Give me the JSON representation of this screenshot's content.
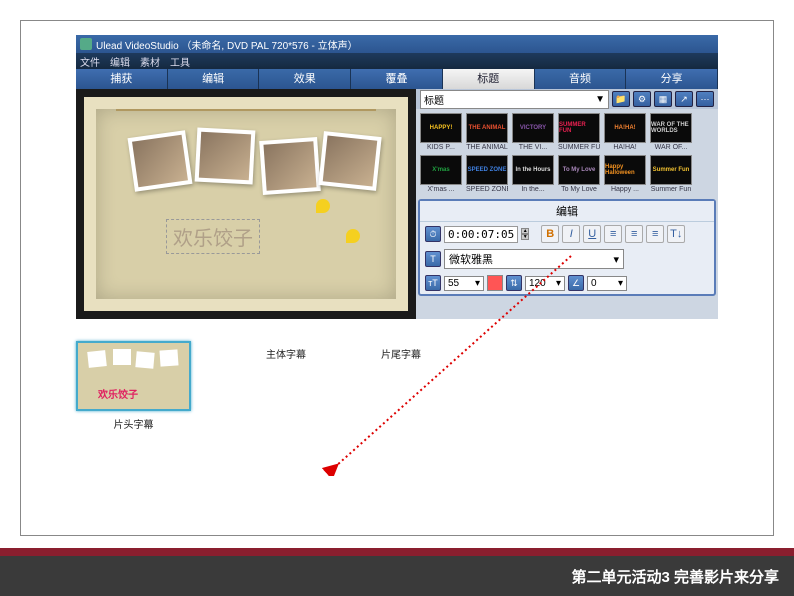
{
  "titlebar": {
    "text": "Ulead VideoStudio （未命名, DVD PAL 720*576 - 立体声）"
  },
  "menu": {
    "file": "文件",
    "edit": "编辑",
    "clip": "素材",
    "tools": "工具"
  },
  "tabs": {
    "capture": "捕获",
    "edit": "编辑",
    "effect": "效果",
    "overlay": "覆叠",
    "title": "标题",
    "audio": "音频",
    "share": "分享"
  },
  "library": {
    "category": "标题"
  },
  "thumbs": [
    {
      "text": "HAPPY!",
      "caption": "KIDS P...",
      "color": "#f5c020"
    },
    {
      "text": "THE ANIMAL",
      "caption": "THE ANIMAL",
      "color": "#e85030"
    },
    {
      "text": "VICTORY",
      "caption": "THE VI...",
      "color": "#8855aa"
    },
    {
      "text": "SUMMER FUN",
      "caption": "SUMMER FUN",
      "color": "#e82050"
    },
    {
      "text": "HA!HA!",
      "caption": "HA!HA!",
      "color": "#f08030"
    },
    {
      "text": "WAR OF THE WORLDS",
      "caption": "WAR OF...",
      "color": "#ccc"
    },
    {
      "text": "X'mas",
      "caption": "X'mas ...",
      "color": "#20a040"
    },
    {
      "text": "SPEED ZONE",
      "caption": "SPEED ZONE",
      "color": "#4080e0"
    },
    {
      "text": "In the Hours",
      "caption": "In the...",
      "color": "#ddd"
    },
    {
      "text": "To My Love",
      "caption": "To My Love",
      "color": "#a8b"
    },
    {
      "text": "Happy Halloween",
      "caption": "Happy ...",
      "color": "#f09020"
    },
    {
      "text": "Summer Fun",
      "caption": "Summer Fun",
      "color": "#f0c030"
    }
  ],
  "canvas": {
    "title_text": "欢乐饺子"
  },
  "edit": {
    "header": "编辑",
    "timecode": "0:00:07:05",
    "bold": "B",
    "italic": "I",
    "underline": "U",
    "font": "微软雅黑",
    "size": "55",
    "leading": "120",
    "rotation": "0"
  },
  "timeline": {
    "clip1": "片头字幕",
    "clip1_text": "欢乐饺子",
    "clip2": "主体字幕",
    "clip3": "片尾字幕"
  },
  "footer": {
    "text": "第二单元活动3 完善影片来分享"
  },
  "chart_data": null
}
